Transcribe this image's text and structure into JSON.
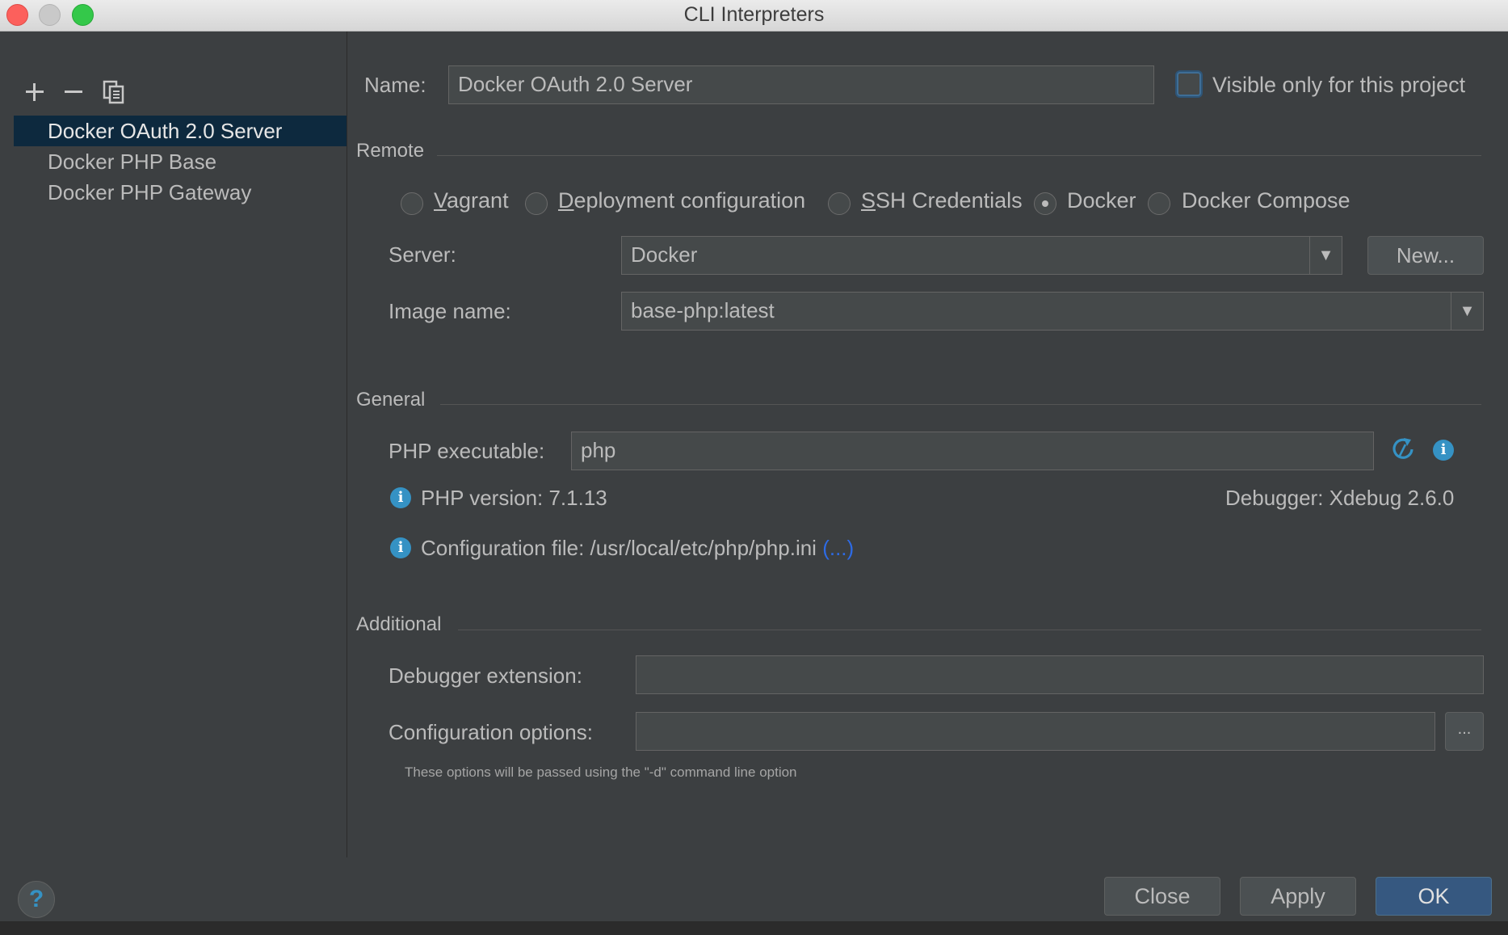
{
  "window": {
    "title": "CLI Interpreters"
  },
  "interpreters": {
    "items": [
      {
        "label": "Docker OAuth 2.0 Server",
        "selected": true
      },
      {
        "label": "Docker PHP Base",
        "selected": false
      },
      {
        "label": "Docker PHP Gateway",
        "selected": false
      }
    ]
  },
  "form": {
    "name_label": "Name:",
    "name_value": "Docker OAuth 2.0 Server",
    "visible_only_label": "Visible only for this project",
    "visible_only_checked": false
  },
  "remote": {
    "title": "Remote",
    "options": [
      {
        "prefix": "",
        "mnemonic": "V",
        "rest": "agrant",
        "checked": false
      },
      {
        "prefix": "",
        "mnemonic": "D",
        "rest": "eployment configuration",
        "checked": false
      },
      {
        "prefix": "",
        "mnemonic": "S",
        "rest": "SH Credentials",
        "checked": false
      },
      {
        "prefix": "Docker",
        "mnemonic": "",
        "rest": "",
        "checked": true
      },
      {
        "prefix": "Docker Compose",
        "mnemonic": "",
        "rest": "",
        "checked": false
      }
    ],
    "server_label": "Server:",
    "server_value": "Docker",
    "new_button": "New...",
    "image_label": "Image name:",
    "image_value": "base-php:latest"
  },
  "general": {
    "title": "General",
    "php_exec_label": "PHP executable:",
    "php_exec_value": "php",
    "php_version_text": "PHP version: 7.1.13",
    "debugger_text": "Debugger: Xdebug 2.6.0",
    "config_file_text": "Configuration file: /usr/local/etc/php/php.ini",
    "config_file_link": "(...)"
  },
  "additional": {
    "title": "Additional",
    "debugger_ext_label": "Debugger extension:",
    "debugger_ext_value": "",
    "config_options_label": "Configuration options:",
    "config_options_value": "",
    "browse_button": "...",
    "hint": "These options will be passed using the \"-d\" command line option"
  },
  "buttons": {
    "help": "?",
    "close": "Close",
    "apply": "Apply",
    "ok": "OK"
  },
  "colors": {
    "background": "#3c3f41",
    "selection": "#0d293e",
    "default_button": "#365880",
    "info_icon": "#3592c4",
    "link": "#2d6be6"
  }
}
